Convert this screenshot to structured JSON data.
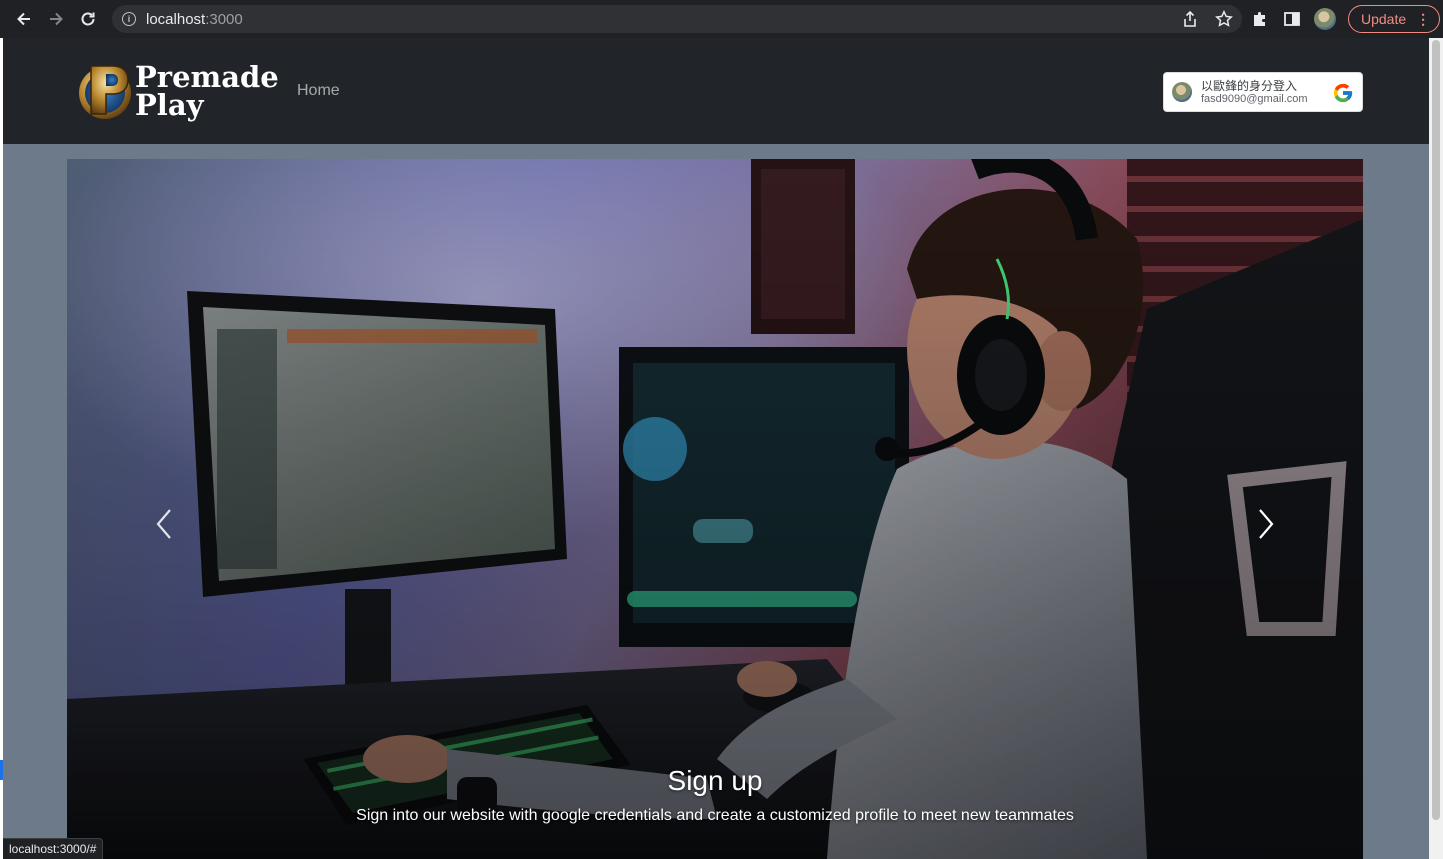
{
  "browser": {
    "url_host": "localhost",
    "url_port": ":3000",
    "update_label": "Update",
    "status_url": "localhost:3000/#"
  },
  "site": {
    "logo_line1": "Premade",
    "logo_line2": "Play",
    "nav_home": "Home"
  },
  "google_signin": {
    "name": "以歐鋒的身分登入",
    "email": "fasd9090@gmail.com"
  },
  "carousel": {
    "caption_title": "Sign up",
    "caption_text": "Sign into our website with google credentials and create a customized profile to meet new teammates",
    "prev_icon": "chevron-left-icon",
    "next_icon": "chevron-right-icon"
  },
  "colors": {
    "navbar_bg": "#212529",
    "page_bg": "#6c7a8a",
    "update_accent": "#f28b82"
  }
}
